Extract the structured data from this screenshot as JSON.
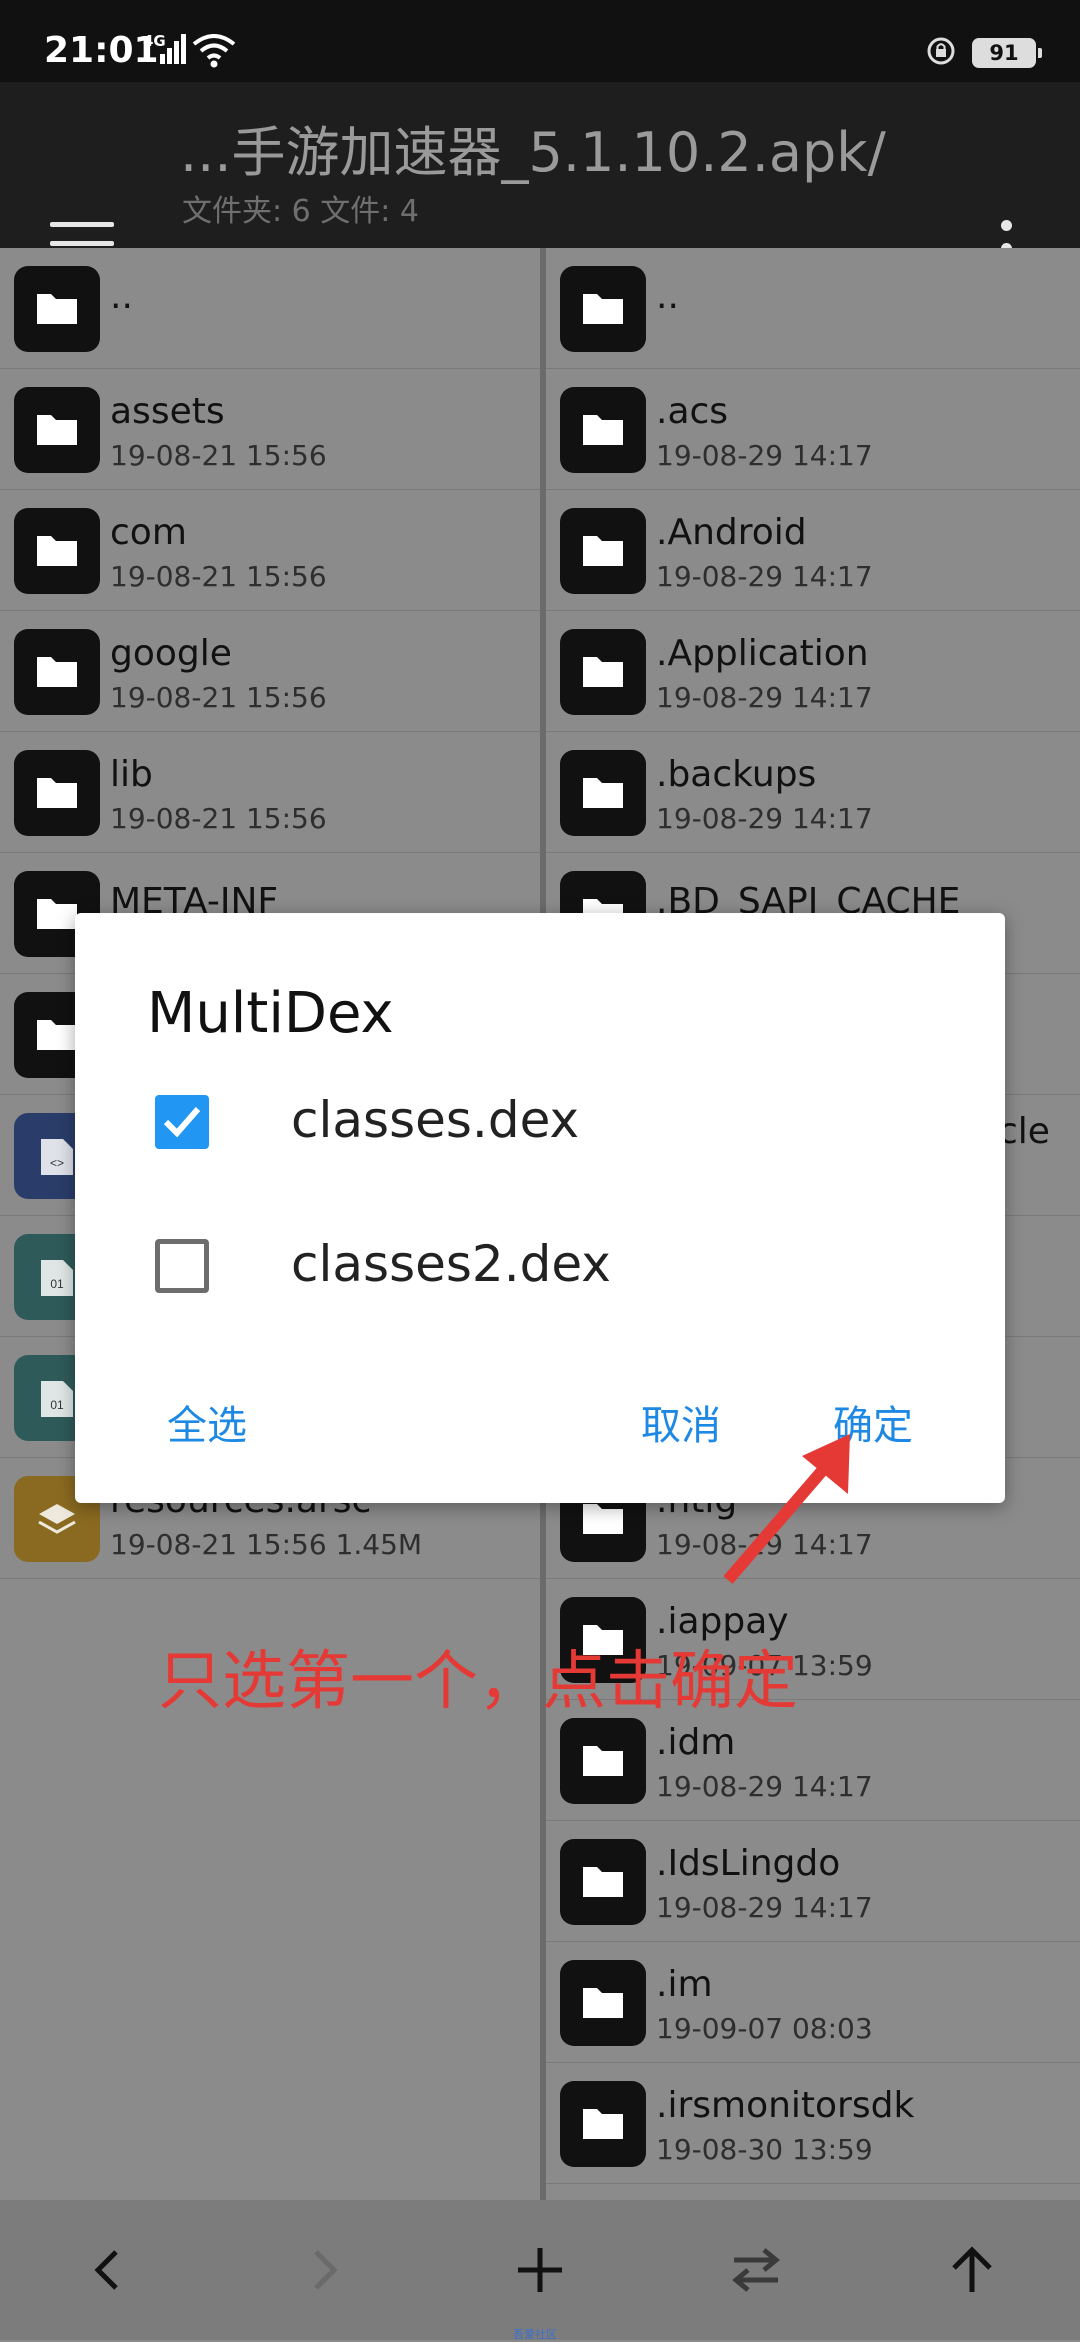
{
  "status": {
    "time": "21:01",
    "network": "4G",
    "battery": "91"
  },
  "header": {
    "path": "...手游加速器_5.1.10.2.apk/",
    "counts": "文件夹: 6  文件: 4"
  },
  "left_pane": [
    {
      "name": "..",
      "meta": "",
      "icon": "folder-icon"
    },
    {
      "name": "assets",
      "meta": "19-08-21 15:56",
      "icon": "folder-icon"
    },
    {
      "name": "com",
      "meta": "19-08-21 15:56",
      "icon": "folder-icon"
    },
    {
      "name": "google",
      "meta": "19-08-21 15:56",
      "icon": "folder-icon"
    },
    {
      "name": "lib",
      "meta": "19-08-21 15:56",
      "icon": "folder-icon"
    },
    {
      "name": "META-INF",
      "meta": "",
      "icon": "folder-icon"
    },
    {
      "name": "",
      "meta": "",
      "icon": "folder-icon"
    },
    {
      "name": "",
      "meta": "",
      "icon": "code-file-icon"
    },
    {
      "name": "",
      "meta": "",
      "icon": "binary-file-icon"
    },
    {
      "name": "",
      "meta": "",
      "icon": "binary-file-icon"
    },
    {
      "name": "resources.arsc",
      "meta": "19-08-21 15:56  1.45M",
      "icon": "layers-icon"
    }
  ],
  "right_pane": [
    {
      "name": "..",
      "meta": ""
    },
    {
      "name": ".acs",
      "meta": "19-08-29 14:17"
    },
    {
      "name": ".Android",
      "meta": "19-08-29 14:17"
    },
    {
      "name": ".Application",
      "meta": "19-08-29 14:17"
    },
    {
      "name": ".backups",
      "meta": "19-08-29 14:17"
    },
    {
      "name": ".BD_SAPI_CACHE",
      "meta": ""
    },
    {
      "name": "",
      "meta": ""
    },
    {
      "name": "cle",
      "meta": ""
    },
    {
      "name": "",
      "meta": ""
    },
    {
      "name": "",
      "meta": ""
    },
    {
      "name": ".htlg",
      "meta": "19-08-29 14:17"
    },
    {
      "name": ".iappay",
      "meta": "19-09-07 13:59"
    },
    {
      "name": ".idm",
      "meta": "19-08-29 14:17"
    },
    {
      "name": ".IdsLingdo",
      "meta": "19-08-29 14:17"
    },
    {
      "name": ".im",
      "meta": "19-09-07 08:03"
    },
    {
      "name": ".irsmonitorsdk",
      "meta": "19-08-30 13:59"
    }
  ],
  "dialog": {
    "title": "MultiDex",
    "options": [
      {
        "label": "classes.dex",
        "checked": true
      },
      {
        "label": "classes2.dex",
        "checked": false
      }
    ],
    "select_all": "全选",
    "cancel": "取消",
    "confirm": "确定"
  },
  "annotation": {
    "text": "只选第一个，点击确定",
    "color": "#e53935"
  },
  "bottom_bar": [
    "back-icon",
    "forward-icon",
    "add-icon",
    "swap-icon",
    "up-arrow-icon"
  ],
  "watermark": "吾爱社区",
  "colors": {
    "accent": "#2196f3",
    "button_text": "#1e88e5"
  }
}
